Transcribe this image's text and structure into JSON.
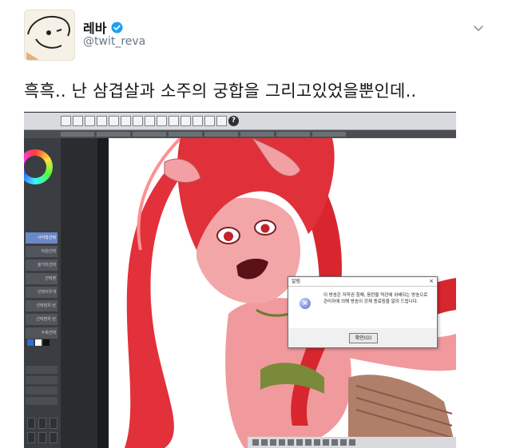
{
  "tweet": {
    "display_name": "레바",
    "handle": "@twit_reva",
    "text": "흑흑.. 난 삼겹살과 소주의 궁합을 그리고있었을뿐인데.."
  },
  "icons": {
    "verified": "verified-badge-icon",
    "more": "chevron-down-icon",
    "dialog_info": "info-icon",
    "help": "help-icon"
  },
  "colors": {
    "verified": "#1da1f2",
    "tool_active": "#6a87c6",
    "canvas_bg": "#ffffff",
    "app_bg": "#3f4246"
  },
  "app": {
    "help_label": "?",
    "tools": [
      "사각형선택",
      "타원선택",
      "올가미선택",
      "선택펜",
      "선택지우개",
      "선택범위 런",
      "선택범위 런",
      "수축선택"
    ],
    "active_tool_index": 0,
    "dialog": {
      "title": "알림",
      "close": "×",
      "message": "이 방송은 저작권 침해, 음란물 약관에 위배되는 방송으로 관리자에 의해 방송이 강제 종료됨을 알려 드립니다.",
      "ok_label": "확인(O)"
    }
  }
}
